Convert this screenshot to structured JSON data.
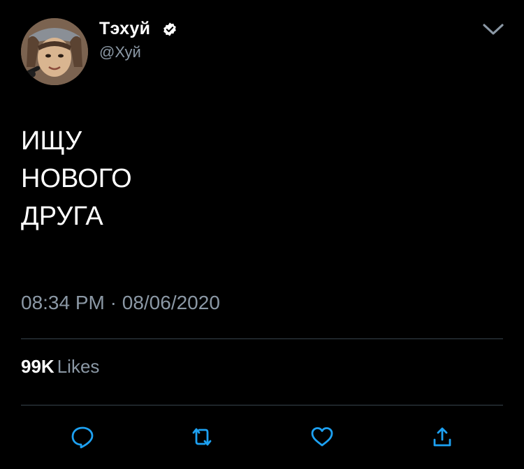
{
  "author": {
    "display_name": "Тэхуй",
    "handle": "@Хуй",
    "verified": true
  },
  "tweet": {
    "lines": [
      "ИЩУ",
      "НОВОГО",
      "ДРУГА"
    ],
    "time": "08:34 PM",
    "separator": "·",
    "date": "08/06/2020"
  },
  "stats": {
    "likes_count": "99K",
    "likes_label": "Likes"
  },
  "actions": [
    "reply-icon",
    "retweet-icon",
    "like-icon",
    "share-icon"
  ],
  "colors": {
    "background": "#000000",
    "text": "#ffffff",
    "secondary": "#8b98a5",
    "divider": "#38444d",
    "icon": "#1da1f2"
  }
}
